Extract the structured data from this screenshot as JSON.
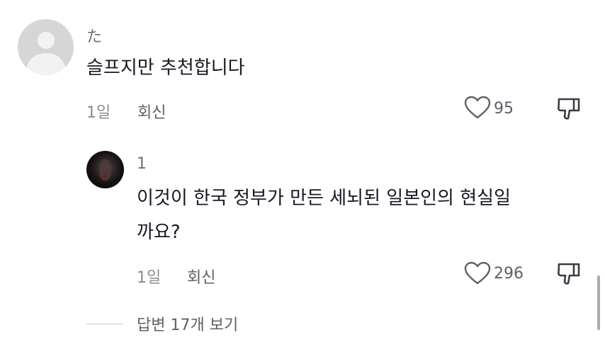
{
  "comment": {
    "username": "た",
    "text": "슬프지만 추천합니다",
    "time": "1일",
    "reply_label": "회신",
    "like_count": "95"
  },
  "reply": {
    "username": "1",
    "text_line1": "이것이 한국 정부가 만든 세뇌된 일본인의 현실일",
    "text_line2": "까요?",
    "time": "1일",
    "reply_label": "회신",
    "like_count": "296"
  },
  "view_replies_label": "답변 17개 보기",
  "icons": {
    "avatar_default": "default-avatar-icon",
    "avatar_user": "user-avatar",
    "like": "heart-outline-icon",
    "dislike": "thumbs-down-icon"
  }
}
